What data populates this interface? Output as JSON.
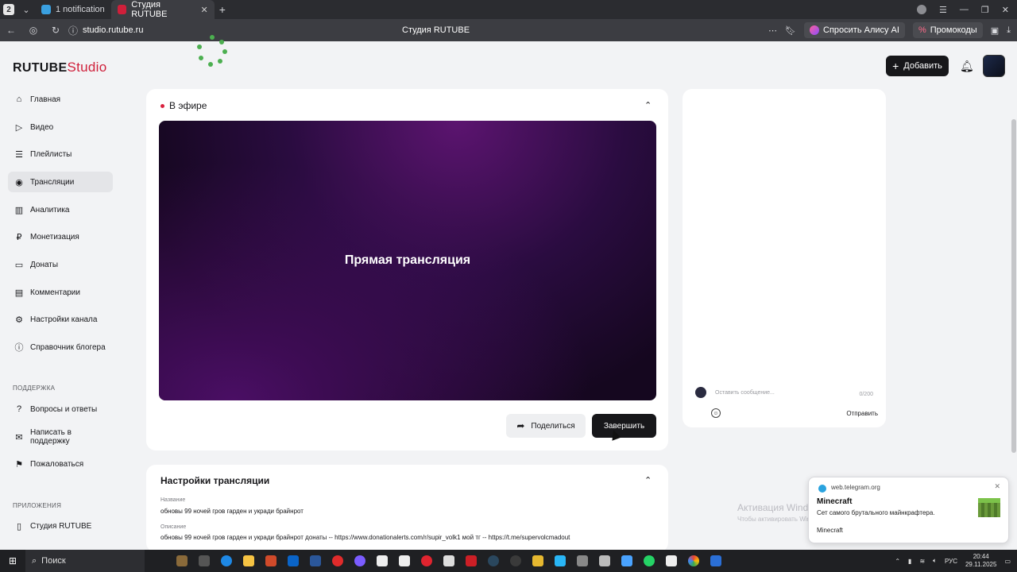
{
  "browser": {
    "tabs": [
      {
        "label": "1 notification",
        "active": false
      },
      {
        "label": "Студия RUTUBE",
        "active": true
      }
    ],
    "tab_counter": "2",
    "url": "studio.rutube.ru",
    "page_title": "Студия RUTUBE",
    "alisa_label": "Спросить Алису AI",
    "promo_label": "Промокоды"
  },
  "header": {
    "logo_main": "RUTUBE",
    "logo_sub": "Studio",
    "add_label": "Добавить"
  },
  "sidebar": {
    "items": [
      {
        "label": "Главная",
        "icon": "home-icon"
      },
      {
        "label": "Видео",
        "icon": "video-icon"
      },
      {
        "label": "Плейлисты",
        "icon": "playlist-icon"
      },
      {
        "label": "Трансляции",
        "icon": "broadcast-icon",
        "active": true
      },
      {
        "label": "Аналитика",
        "icon": "analytics-icon"
      },
      {
        "label": "Монетизация",
        "icon": "ruble-icon"
      },
      {
        "label": "Донаты",
        "icon": "donate-icon"
      },
      {
        "label": "Комментарии",
        "icon": "comment-icon"
      },
      {
        "label": "Настройки канала",
        "icon": "gear-icon"
      },
      {
        "label": "Справочник блогера",
        "icon": "info-icon"
      }
    ],
    "support_heading": "ПОДДЕРЖКА",
    "support_items": [
      {
        "label": "Вопросы и ответы",
        "icon": "question-icon"
      },
      {
        "label": "Написать в поддержку",
        "icon": "mail-icon"
      },
      {
        "label": "Пожаловаться",
        "icon": "flag-icon"
      }
    ],
    "apps_heading": "ПРИЛОЖЕНИЯ",
    "apps_items": [
      {
        "label": "Студия RUTUBE",
        "icon": "rutube-app-icon"
      }
    ]
  },
  "live": {
    "status_label": "В эфире",
    "player_title": "Прямая трансляция",
    "share_label": "Поделиться",
    "end_label": "Завершить"
  },
  "settings": {
    "title": "Настройки трансляции",
    "name_label": "Название",
    "name_value": "обновы 99 ночей гров гарден и укради брайнрот",
    "desc_label": "Описание",
    "desc_value": "обновы 99 ночей гров гарден и укради брайнрот донаты -- https://www.donationalerts.com/r/supir_volk1 мой тг -- https://t.me/supervolcmadout"
  },
  "chat": {
    "placeholder": "Оставить сообщение...",
    "counter": "0/200",
    "send_label": "Отправить"
  },
  "toast": {
    "source": "web.telegram.org",
    "title": "Minecraft",
    "body": "Сет самого брутального майнкрафтера.",
    "footer": "Minecraft"
  },
  "watermark": {
    "line1": "Активация Windows",
    "line2": "Чтобы активировать Windows, перейдите в раздел \"Параметры\"."
  },
  "taskbar": {
    "search_label": "Поиск",
    "lang": "РУС",
    "time": "20:44",
    "date": "29.11.2025"
  }
}
